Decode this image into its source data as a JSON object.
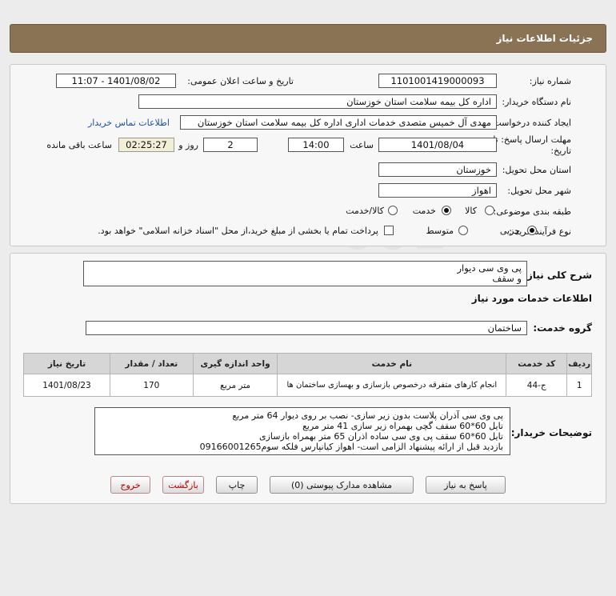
{
  "header": {
    "title": "جزئیات اطلاعات نیاز"
  },
  "form": {
    "need_number_label": "شماره نیاز:",
    "need_number": "1101001419000093",
    "announce_label": "تاریخ و ساعت اعلان عمومی:",
    "announce_value": "1401/08/02 - 11:07",
    "buyer_org_label": "نام دستگاه خریدار:",
    "buyer_org": "اداره کل بیمه سلامت استان خوزستان",
    "requester_label": "ایجاد کننده درخواست:",
    "requester": "مهدی آل خمیس متصدی خدمات اداری اداره کل بیمه سلامت استان خوزستان",
    "contact_link": "اطلاعات تماس خریدار",
    "deadline_label_1": "مهلت ارسال پاسخ: تا",
    "deadline_label_2": "تاریخ:",
    "deadline_date": "1401/08/04",
    "time_label": "ساعت",
    "deadline_time": "14:00",
    "days_value": "2",
    "days_label": "روز و",
    "remaining_time": "02:25:27",
    "remaining_label": "ساعت باقی مانده",
    "province_label": "استان محل تحویل:",
    "province": "خوزستان",
    "city_label": "شهر محل تحویل:",
    "city": "اهواز",
    "category_label": "طبقه بندی موضوعی:",
    "category_options": [
      "کالا",
      "خدمت",
      "کالا/خدمت"
    ],
    "purchase_label": "نوع فرآیند خرید :",
    "purchase_options": [
      "جزیی",
      "متوسط"
    ],
    "payment_note": "پرداخت تمام یا بخشی از مبلغ خرید،از محل \"اسناد خزانه اسلامی\" خواهد بود."
  },
  "summary": {
    "label": "شرح کلی نیاز:",
    "lines": [
      "پی وی سی دیوار",
      "و سقف"
    ]
  },
  "services": {
    "section_title": "اطلاعات خدمات مورد نیاز",
    "group_label": "گروه خدمت:",
    "group_value": "ساختمان",
    "table_headers": [
      "ردیف",
      "کد خدمت",
      "نام خدمت",
      "واحد اندازه گیری",
      "تعداد / مقدار",
      "تاریخ نیاز"
    ],
    "rows": [
      {
        "row": "1",
        "code": "ج-44",
        "name": "انجام کارهای متفرقه درخصوص بازسازی و بهسازی ساختمان ها",
        "unit": "متر مربع",
        "qty": "170",
        "date": "1401/08/23"
      }
    ]
  },
  "buyer_notes": {
    "label": "توضیحات خریدار:",
    "lines": [
      "پی وی سی آذران پلاست بدون زیر سازی- نصب  بر روی دیوار 64 متر مربع",
      "تایل 60*60 سقف گچی بهمراه زیر سازی 41 متر مربع",
      "تایل 60*60 سقف پی وی سی ساده اذران 65 متر بهمراه بازسازی",
      "بازدید قبل از ارائه پیشنهاد الزامی است- اهواز کیانپارس فلکه سوم09166001265"
    ]
  },
  "buttons": {
    "reply": "پاسخ به نیاز",
    "attachments": "مشاهده مدارک پیوستی (0)",
    "print": "چاپ",
    "back": "بازگشت",
    "exit": "خروج"
  },
  "colors": {
    "titlebar": "#8a7355",
    "link": "#1d4fa8",
    "remaining_bg": "#f3efd6"
  }
}
